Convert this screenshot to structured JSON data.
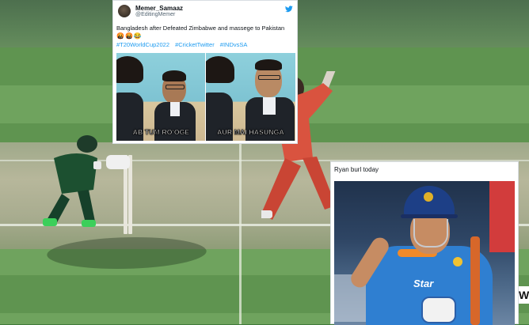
{
  "tweet": {
    "display_name": "Memer_Samaaz",
    "handle": "@EditingMemer",
    "text": "Bangladesh after Defeated Zimbabwe and massege to Pakistan",
    "emojis": "🤬🤬😂",
    "hashtags": [
      "#T20WorldCup2022",
      "#CricketTwitter",
      "#INDvsSA"
    ],
    "meme_captions": {
      "left": "AB TUM RO'OGE",
      "right": "AUR MAI HASUNGA"
    },
    "icons": {
      "platform": "twitter-bird-icon"
    }
  },
  "card2": {
    "text": "Ryan burl today",
    "sponsor_text": "Star"
  },
  "edge_letter": "W",
  "colors": {
    "twitter_blue": "#1d9bf0",
    "field_green": "#5f9450",
    "india_blue": "#2f7fd1"
  }
}
